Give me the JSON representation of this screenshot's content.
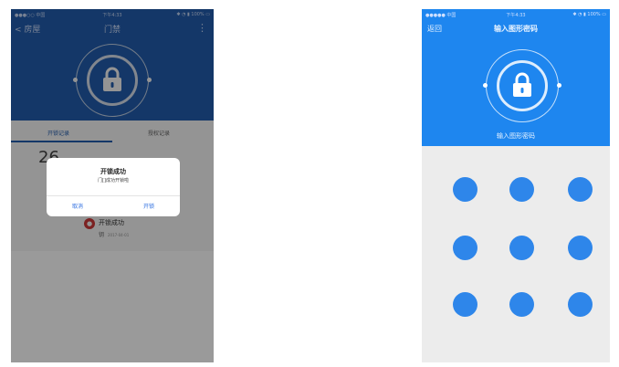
{
  "left_screen": {
    "status": {
      "carrier": "●●●○○ 中国",
      "time": "下午4:33",
      "battery": "✱ ◔ ▮ 100% ▭"
    },
    "nav": {
      "back": "< 房屋",
      "title": "门禁",
      "more": "⋮"
    },
    "tabs": [
      {
        "label": "开锁记录",
        "active": true
      },
      {
        "label": "授权记录",
        "active": false
      }
    ],
    "content": {
      "number": "26",
      "record_title": "开锁成功",
      "record_sub": "钥",
      "record_time": "2017-04-01"
    },
    "dialog": {
      "title": "开锁成功",
      "message": "门[]成功开锁啦",
      "cancel": "取消",
      "confirm": "开锁"
    }
  },
  "right_screen": {
    "status": {
      "carrier": "●●●●● 中国",
      "time": "下午4:33",
      "battery": "✱ ◔ ▮ 100% ▭"
    },
    "nav": {
      "back": "返回",
      "title": "输入图形密码"
    },
    "hint": "输入图形密码",
    "pattern": {
      "rows": 3,
      "cols": 3
    }
  },
  "colors": {
    "left_header": "#2460b3",
    "right_header": "#1e86ef",
    "pattern_dot": "#2e86ea"
  },
  "icons": [
    "lock-icon",
    "more-icon",
    "back-chevron-icon"
  ]
}
